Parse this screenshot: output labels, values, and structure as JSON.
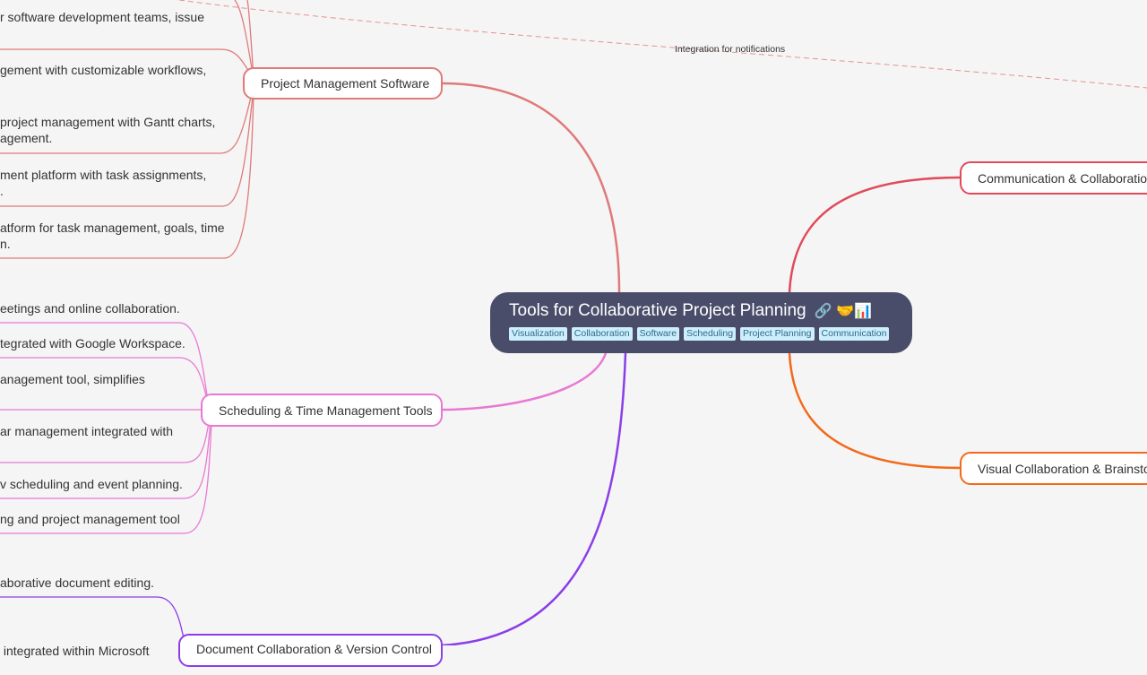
{
  "colors": {
    "background": "#f5f5f5",
    "root": "#4a4d6a",
    "tag_bg": "#cdeefb",
    "tag_text": "#2d6a8c",
    "project_management": "#e07a7a",
    "scheduling": "#e879d3",
    "document": "#8b3ee8",
    "communication": "#e04a5a",
    "visual": "#f26a1b"
  },
  "root": {
    "title": "Tools for Collaborative Project Planning",
    "icons": [
      "link-icon",
      "handshake-icon",
      "bar-chart-icon"
    ],
    "icon_glyphs": "🔗 🤝📊",
    "tags": [
      "Visualization",
      "Collaboration",
      "Software",
      "Scheduling",
      "Project Planning",
      "Communication"
    ]
  },
  "branches": {
    "project_management": {
      "label": "Project Management Software",
      "leaves": [
        [
          "r software development teams, issue"
        ],
        [
          "gement with customizable workflows,"
        ],
        [
          "project management with Gantt charts,",
          "agement."
        ],
        [
          "ment platform with task assignments,",
          "."
        ],
        [
          "atform for task management, goals, time",
          "n."
        ]
      ]
    },
    "scheduling": {
      "label": "Scheduling & Time Management Tools",
      "leaves": [
        [
          "eetings and online collaboration."
        ],
        [
          "tegrated with Google Workspace."
        ],
        [
          "anagement tool, simplifies"
        ],
        [
          "ar management integrated with"
        ],
        [
          "v scheduling and event planning."
        ],
        [
          "ng and project management tool"
        ]
      ]
    },
    "document": {
      "label": "Document Collaboration & Version Control",
      "leaves": [
        [
          "aborative document editing."
        ],
        [
          " integrated within Microsoft"
        ]
      ]
    },
    "communication": {
      "label": "Communication & Collaboration"
    },
    "visual": {
      "label": "Visual Collaboration & Brainstorming"
    }
  },
  "cross_link": {
    "label": "Integration for notifications"
  }
}
